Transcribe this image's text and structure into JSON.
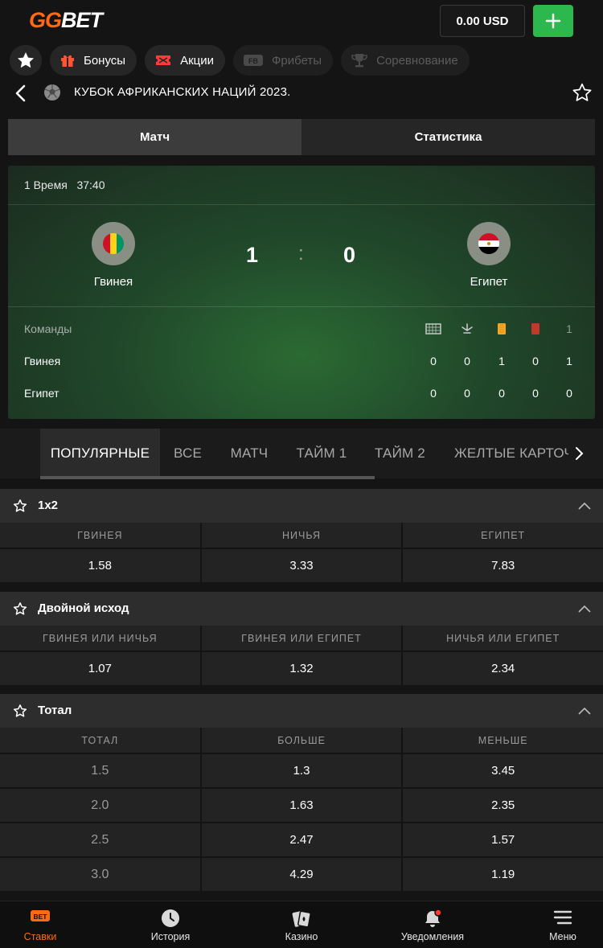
{
  "header": {
    "logo_gg": "GG",
    "logo_bet": "BET",
    "balance": "0.00 USD"
  },
  "chips": [
    {
      "label": "Бонусы",
      "icon": "gift-icon",
      "color": "#ff5533",
      "enabled": true
    },
    {
      "label": "Акции",
      "icon": "ticket-icon",
      "color": "#ff3b3b",
      "enabled": true
    },
    {
      "label": "Фрибеты",
      "icon": "freebet-icon",
      "enabled": false
    },
    {
      "label": "Соревнование",
      "icon": "trophy-icon",
      "enabled": false
    }
  ],
  "league": "КУБОК АФРИКАНСКИХ НАЦИЙ 2023.",
  "view_tabs": {
    "match": "Матч",
    "stats": "Статистика",
    "active": "match"
  },
  "match": {
    "period": "1 Время",
    "clock": "37:40",
    "home": {
      "name": "Гвинея",
      "score": "1",
      "flag_colors": [
        "#ce1126",
        "#fcd116",
        "#009460"
      ]
    },
    "away": {
      "name": "Египет",
      "score": "0",
      "flag_colors": [
        "#ce1126",
        "#ffffff",
        "#000000"
      ]
    },
    "separator": ":"
  },
  "stats": {
    "header_label": "Команды",
    "columns": [
      "corner-icon",
      "penalty-icon",
      "yellow-card-icon",
      "red-card-icon",
      "1"
    ],
    "rows": [
      {
        "team": "Гвинея",
        "values": [
          "0",
          "0",
          "1",
          "0",
          "1"
        ]
      },
      {
        "team": "Египет",
        "values": [
          "0",
          "0",
          "0",
          "0",
          "0"
        ]
      }
    ]
  },
  "market_tabs": [
    "ПОПУЛЯРНЫЕ",
    "ВСЕ",
    "МАТЧ",
    "ТАЙМ 1",
    "ТАЙМ 2",
    "ЖЕЛТЫЕ КАРТОЧ"
  ],
  "markets": {
    "m1x2": {
      "title": "1x2",
      "headers": [
        "ГВИНЕЯ",
        "НИЧЬЯ",
        "ЕГИПЕТ"
      ],
      "odds": [
        "1.58",
        "3.33",
        "7.83"
      ]
    },
    "double": {
      "title": "Двойной исход",
      "headers": [
        "ГВИНЕЯ ИЛИ НИЧЬЯ",
        "ГВИНЕЯ ИЛИ ЕГИПЕТ",
        "НИЧЬЯ ИЛИ ЕГИПЕТ"
      ],
      "odds": [
        "1.07",
        "1.32",
        "2.34"
      ]
    },
    "total": {
      "title": "Тотал",
      "headers": [
        "ТОТАЛ",
        "БОЛЬШЕ",
        "МЕНЬШЕ"
      ],
      "rows": [
        [
          "1.5",
          "1.3",
          "3.45"
        ],
        [
          "2.0",
          "1.63",
          "2.35"
        ],
        [
          "2.5",
          "2.47",
          "1.57"
        ],
        [
          "3.0",
          "4.29",
          "1.19"
        ]
      ]
    }
  },
  "bottom_nav": [
    {
      "label": "Ставки",
      "icon": "bet-icon",
      "active": true
    },
    {
      "label": "История",
      "icon": "clock-icon",
      "active": false
    },
    {
      "label": "Казино",
      "icon": "cards-icon",
      "active": false
    },
    {
      "label": "Уведомления",
      "icon": "bell-icon",
      "active": false
    },
    {
      "label": "Меню",
      "icon": "menu-icon",
      "active": false
    }
  ],
  "colors": {
    "accent": "#ff6a13",
    "green": "#2db84d"
  }
}
